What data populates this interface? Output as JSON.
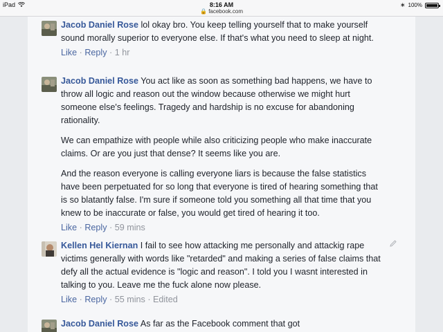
{
  "status_bar": {
    "device": "iPad",
    "time": "8:16 AM",
    "url": "facebook.com",
    "battery": "100%"
  },
  "comments": [
    {
      "author": "Jacob Daniel Rose",
      "paragraphs": [
        "lol okay bro. You keep telling yourself that to make yourself sound morally superior to everyone else. If that's what you need to sleep at night."
      ],
      "like": "Like",
      "reply": "Reply",
      "time": "1 hr"
    },
    {
      "author": "Jacob Daniel Rose",
      "paragraphs": [
        "You act like as soon as something bad happens, we have to throw all logic and reason out the window because otherwise we might hurt someone else's feelings. Tragedy and hardship is no excuse for abandoning rationality.",
        "We can empathize with people while also criticizing people who make inaccurate claims. Or are you just that dense? It seems like you are.",
        "And the reason everyone is calling everyone liars is because the false statistics have been perpetuated for so long that everyone is tired of hearing something that is so blatantly false. I'm sure if someone told you something all that time that you knew to be inaccurate or false, you would get tired of hearing it too."
      ],
      "like": "Like",
      "reply": "Reply",
      "time": "59 mins"
    },
    {
      "author": "Kellen Hel Kiernan",
      "paragraphs": [
        "I fail to see how attacking me personally and attackig rape victims generally with words like \"retarded\" and making a series of false claims that defy all the actual evidence is \"logic and reason\". I told you I wasnt interested in talking to you. Leave me the fuck alone now please."
      ],
      "like": "Like",
      "reply": "Reply",
      "time": "55 mins",
      "edited": "Edited"
    },
    {
      "author": "Jacob Daniel Rose",
      "paragraphs": [
        "As far as the Facebook comment that got"
      ]
    }
  ]
}
